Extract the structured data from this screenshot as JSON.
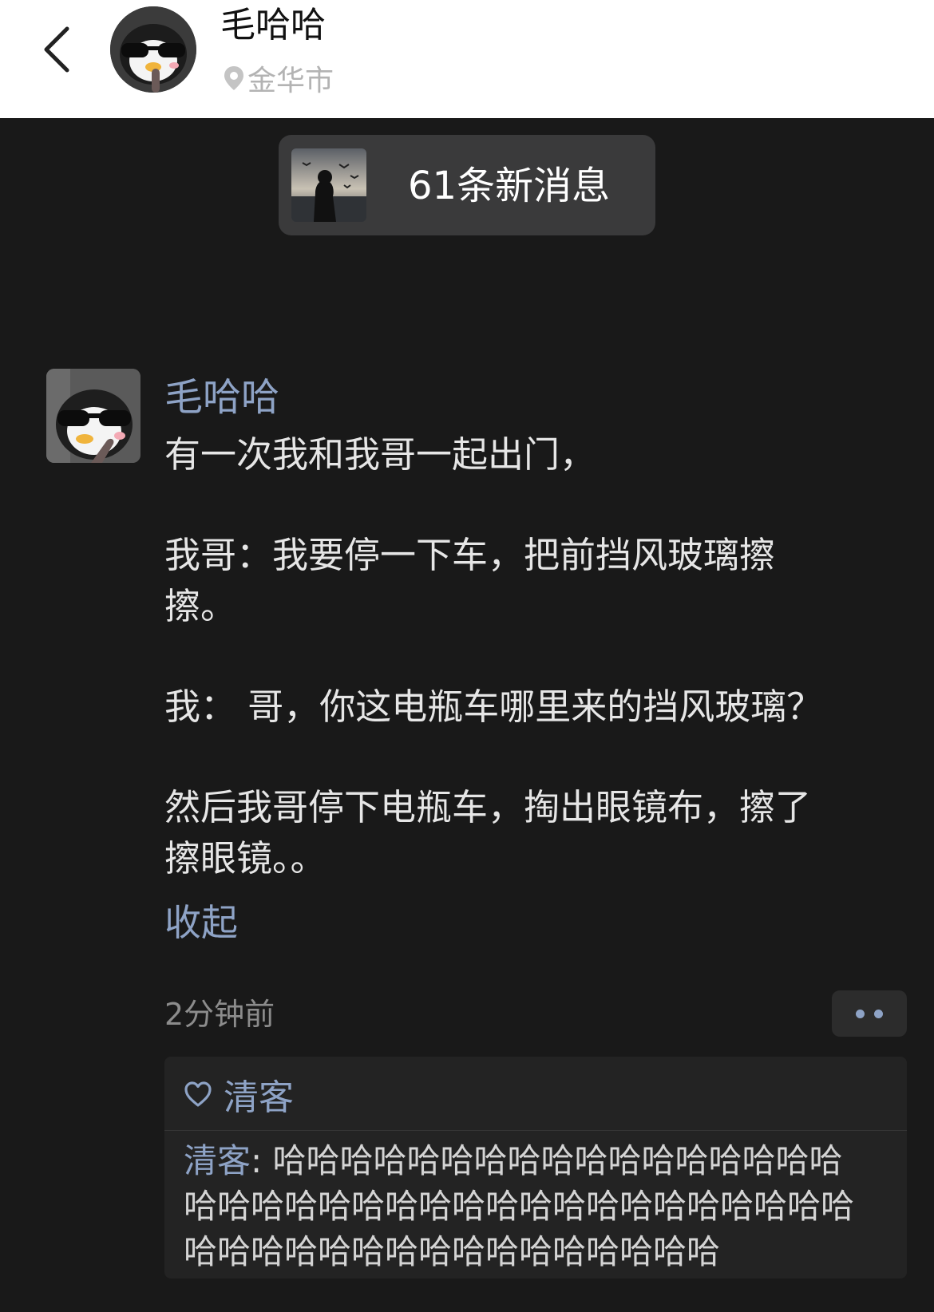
{
  "header": {
    "name": "毛哈哈",
    "location": "金华市",
    "icons": {
      "back": "back-chevron-icon",
      "location": "location-pin-icon"
    }
  },
  "new_messages": {
    "label": "61条新消息"
  },
  "post": {
    "author": "毛哈哈",
    "lines": [
      [
        "有一次我和我哥一起出门，"
      ],
      [
        "我哥：我要停一下车，把前挡风玻璃擦",
        "擦。"
      ],
      [
        "我：  哥，你这电瓶车哪里来的挡风玻璃？"
      ],
      [
        "然后我哥停下电瓶车，掏出眼镜布，擦了",
        "擦眼镜。。"
      ]
    ],
    "collapse_label": "收起",
    "time": "2分钟前"
  },
  "interactions": {
    "like_icon": "heart-outline-icon",
    "likes": [
      "清客"
    ],
    "comments": [
      {
        "author": "清客",
        "separator": ": ",
        "lines": [
          "哈哈哈哈哈哈哈哈哈哈哈哈哈哈哈哈哈",
          "哈哈哈哈哈哈哈哈哈哈哈哈哈哈哈哈哈哈哈哈",
          "哈哈哈哈哈哈哈哈哈哈哈哈哈哈哈哈"
        ]
      }
    ]
  },
  "colors": {
    "background": "#191919",
    "header_bg": "#ffffff",
    "link": "#8ea3c6",
    "body_text": "#e6e6e6",
    "muted_text": "#8c8c8c"
  }
}
